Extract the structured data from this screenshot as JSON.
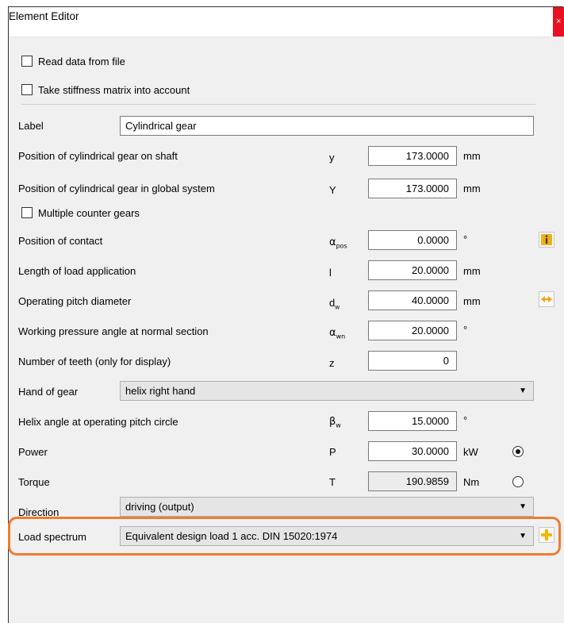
{
  "window": {
    "title": "Element Editor",
    "close_label": "×"
  },
  "checkboxes": {
    "read_file": "Read data from file",
    "stiffness": "Take stiffness matrix into account",
    "multiple_counter": "Multiple counter gears"
  },
  "label": {
    "text": "Label",
    "value": "Cylindrical gear"
  },
  "rows": {
    "pos_shaft": {
      "label": "Position of cylindrical gear on shaft",
      "symbol": "y",
      "value": "173.0000",
      "unit": "mm"
    },
    "pos_global": {
      "label": "Position of cylindrical gear in global system",
      "symbol": "Y",
      "value": "173.0000",
      "unit": "mm"
    },
    "pos_contact": {
      "label": "Position of contact",
      "symbol": "α",
      "symbol_sub": "pos",
      "value": "0.0000",
      "unit": "°"
    },
    "load_len": {
      "label": "Length of load application",
      "symbol": "l",
      "value": "20.0000",
      "unit": "mm"
    },
    "pitch_dia": {
      "label": "Operating pitch diameter",
      "symbol": "d",
      "symbol_sub": "w",
      "value": "40.0000",
      "unit": "mm"
    },
    "pressure_angle": {
      "label": "Working pressure angle at normal section",
      "symbol": "α",
      "symbol_sub": "wn",
      "value": "20.0000",
      "unit": "°"
    },
    "teeth": {
      "label": "Number of teeth (only for display)",
      "symbol": "z",
      "value": "0"
    },
    "helix_angle": {
      "label": "Helix angle at operating pitch circle",
      "symbol": "β",
      "symbol_sub": "w",
      "value": "15.0000",
      "unit": "°"
    },
    "power": {
      "label": "Power",
      "symbol": "P",
      "value": "30.0000",
      "unit": "kW"
    },
    "torque": {
      "label": "Torque",
      "symbol": "T",
      "value": "190.9859",
      "unit": "Nm"
    }
  },
  "hand": {
    "label": "Hand of gear",
    "value": "helix right hand"
  },
  "direction": {
    "label": "Direction",
    "value": "driving (output)"
  },
  "load_spectrum": {
    "label": "Load spectrum",
    "value": "Equivalent design load 1 acc. DIN 15020:1974"
  },
  "power_selected": true,
  "colors": {
    "highlight": "#ed7d31",
    "info_icon": "#d4a017",
    "arrow_icon": "#f0a30a",
    "plus_icon": "#f2b705",
    "close": "#e81123"
  },
  "icons": {
    "info": "info-icon",
    "swap": "swap-arrows-icon",
    "add": "plus-icon",
    "dropdown": "chevron-down-icon"
  }
}
